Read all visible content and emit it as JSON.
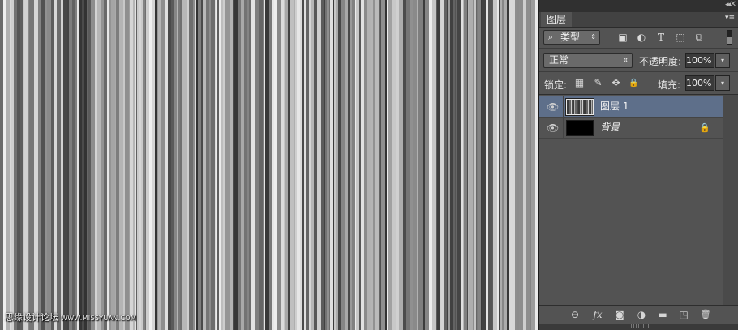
{
  "watermark": {
    "text": "思缘设计论坛",
    "url": "WWW.MISSYUAN.COM"
  },
  "layers_panel": {
    "tab_label": "图层",
    "filter": {
      "selected": "类型",
      "icons": [
        "image-filter-icon",
        "adjustment-filter-icon",
        "type-filter-icon",
        "shape-filter-icon",
        "smart-object-filter-icon"
      ]
    },
    "blend_mode": "正常",
    "opacity": {
      "label": "不透明度:",
      "value": "100%"
    },
    "lock": {
      "label": "锁定:"
    },
    "fill": {
      "label": "填充:",
      "value": "100%"
    },
    "layers": [
      {
        "name": "图层 1",
        "visible": true,
        "selected": true,
        "locked": false
      },
      {
        "name": "背景",
        "visible": true,
        "selected": false,
        "locked": true
      }
    ],
    "footer_icons": [
      "link-layers-icon",
      "layer-style-fx-icon",
      "add-mask-icon",
      "adjustment-layer-icon",
      "new-group-icon",
      "new-layer-icon",
      "delete-layer-icon"
    ]
  },
  "glyphs": {
    "collapse": "◂◂",
    "close": "✕",
    "menu": "▾≡",
    "search": "⌕",
    "arrows_updown": "⇕",
    "dropdown": "▾",
    "filter_image": "▣",
    "filter_adjust": "◐",
    "filter_type": "T",
    "filter_shape": "⬚",
    "filter_smart": "⧉",
    "lock_pixels": "▦",
    "lock_paint": "✎",
    "lock_move": "✥",
    "lock_all": "🔒",
    "eye": "👁",
    "padlock": "🔒",
    "link": "⊖",
    "fx": "fx",
    "mask": "◙",
    "adjust": "◑",
    "folder": "▬",
    "new_layer": "◳",
    "trash": "🗑"
  },
  "colors": {
    "selected_layer": "#5e6f8a",
    "panel_bg": "#535353",
    "canvas_stripe_dark": "#3c3c3c",
    "canvas_stripe_light": "#d8d8d8"
  }
}
